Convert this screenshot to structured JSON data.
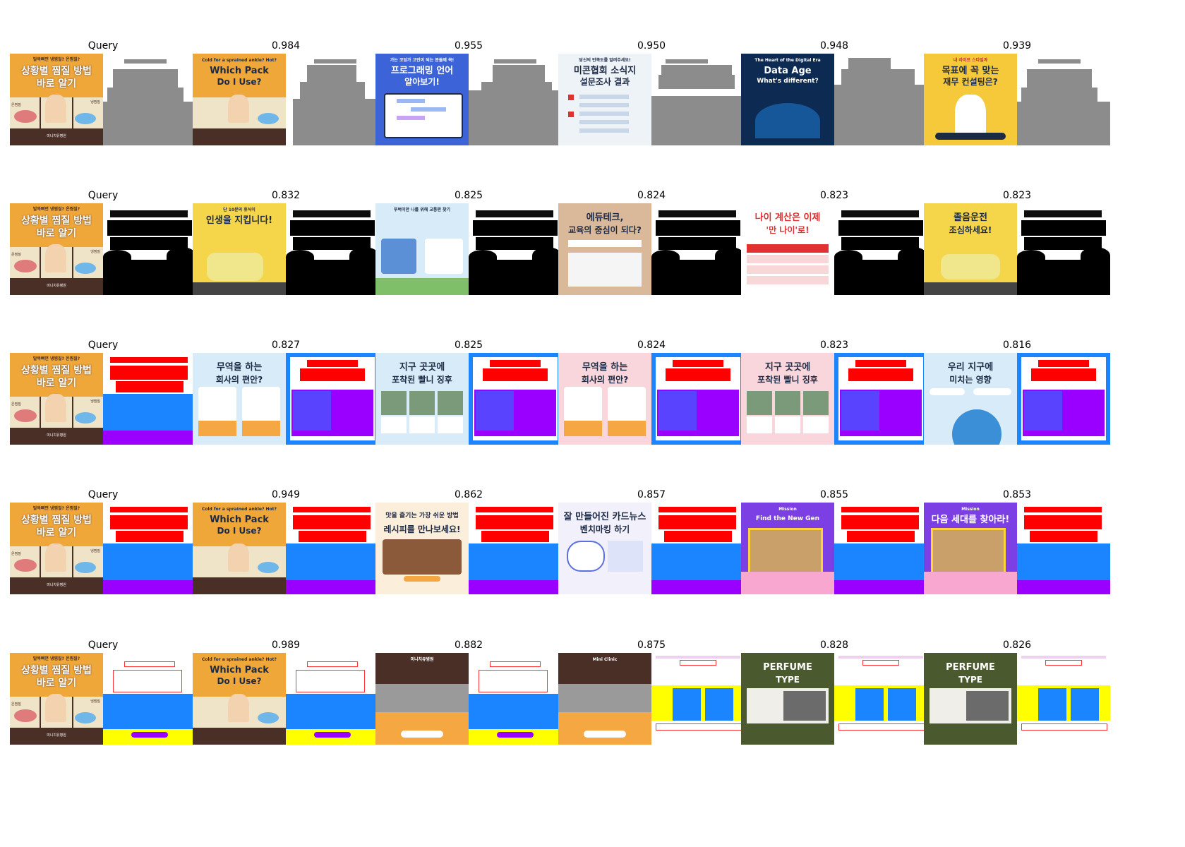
{
  "rows": [
    {
      "query_label": "Query",
      "scores": [
        "0.984",
        "0.955",
        "0.950",
        "0.948",
        "0.939"
      ],
      "mask_style": "gray"
    },
    {
      "query_label": "Query",
      "scores": [
        "0.832",
        "0.825",
        "0.824",
        "0.823",
        "0.823"
      ],
      "mask_style": "black"
    },
    {
      "query_label": "Query",
      "scores": [
        "0.827",
        "0.825",
        "0.824",
        "0.823",
        "0.816"
      ],
      "mask_style": "color"
    },
    {
      "query_label": "Query",
      "scores": [
        "0.949",
        "0.862",
        "0.857",
        "0.855",
        "0.853"
      ],
      "mask_style": "color"
    },
    {
      "query_label": "Query",
      "scores": [
        "0.989",
        "0.882",
        "0.875",
        "0.828",
        "0.826"
      ],
      "mask_style": "outline"
    }
  ],
  "query_thumb": {
    "top_text": "발목삐면 냉찜질? 온찜질?",
    "title_line1": "상황별 찜질 방법",
    "title_line2": "바로 알기",
    "label_left": "온찜질",
    "label_right": "냉찜질",
    "footer": "미니치유병원",
    "colors": {
      "bg": "#f0a73a",
      "bottom": "#4a2f26",
      "title": "#ffffff"
    }
  },
  "thumbs": {
    "which_pack": {
      "top": "Cold for a sprained ankle? Hot?",
      "line1": "Which Pack",
      "line2": "Do I Use?",
      "left": "Hot",
      "right": "Cold",
      "footer": "Mini Clinic",
      "bg": "#f0a73a",
      "bottom": "#4a2f26"
    },
    "programming": {
      "top": "가는 코딩가 고민이 되는 분들께 꼭!",
      "line1": "프로그래밍 언어",
      "line2": "알아보기!",
      "bg": "#3d63d8"
    },
    "survey": {
      "top": "당신의 만족도를 알려주세요!",
      "line1": "미콘협회 소식지",
      "line2": "설문조사 결과",
      "bg": "#eef3f8"
    },
    "data_age": {
      "top": "The Heart of the Digital Era",
      "line1": "Data Age",
      "line2": "What's different?",
      "bg": "#0d2a52"
    },
    "finance": {
      "top": "내 라이프 스타일과",
      "line1": "목표에 꼭 맞는",
      "line2": "재무 컨설팅은?",
      "bg": "#f5c93a"
    },
    "rest": {
      "top": "단 10분의 휴식이",
      "line1": "인생을 지킵니다!",
      "bg": "#f5d64a"
    },
    "travel": {
      "top": "뚜벅이만 나를 위해 교통편 찾기",
      "bg": "#d7ecf8"
    },
    "edutech": {
      "line1": "에듀테크,",
      "line2": "교육의 중심이 되다?",
      "bg": "#d9b99a"
    },
    "age": {
      "line1": "나이 계산은 이제",
      "line2": "'만 나이'로!",
      "bg": "#ffffff"
    },
    "drowsy": {
      "line1": "졸음운전",
      "line2": "조심하세요!",
      "bg": "#f5d64a"
    },
    "trade": {
      "line1": "무역을 하는",
      "line2": "회사의 편안?",
      "bg": "#d7ecf8"
    },
    "trade_pink": {
      "line1": "무역을 하는",
      "line2": "회사의 편안?",
      "bg": "#f8d6dc"
    },
    "global": {
      "line1": "지구 곳곳에",
      "line2": "포착된 빨니 징후",
      "bg": "#d7ecf8"
    },
    "global_pink": {
      "line1": "지구 곳곳에",
      "line2": "포착된 빨니 징후",
      "bg": "#f8d6dc"
    },
    "earth": {
      "line1": "우리 지구에",
      "line2": "미치는 영향",
      "bg": "#d7ecf8"
    },
    "recipe": {
      "line1": "맛을 즐기는 가장 쉬운 방법",
      "line2": "레시피를 만나보세요!",
      "bg": "#fbeedb"
    },
    "cardnews": {
      "line1": "잘 만들어진 카드뉴스",
      "line2": "벤치마킹 하기",
      "bg": "#f2f0fb"
    },
    "mission_en": {
      "top": "Mission",
      "line1": "Find the New Gen",
      "bg": "#7b3fe4"
    },
    "mission_ko": {
      "top": "Mission",
      "line1": "다음 세대를 찾아라!",
      "bg": "#7b3fe4"
    },
    "clinic_ko": {
      "top": "미니치유병원",
      "bg": "#4a2f26"
    },
    "clinic_en": {
      "top": "Mini Clinic",
      "bg": "#4a2f26"
    },
    "perfume": {
      "line1": "PERFUME",
      "line2": "TYPE",
      "bg": "#4a5a2e"
    }
  },
  "colors": {
    "mask_gray": "#8c8c8c",
    "mask_black": "#000000",
    "mask_red": "#ff0000",
    "mask_blue": "#1a85ff",
    "mask_purple": "#9900ff",
    "mask_yellow": "#ffff00"
  }
}
